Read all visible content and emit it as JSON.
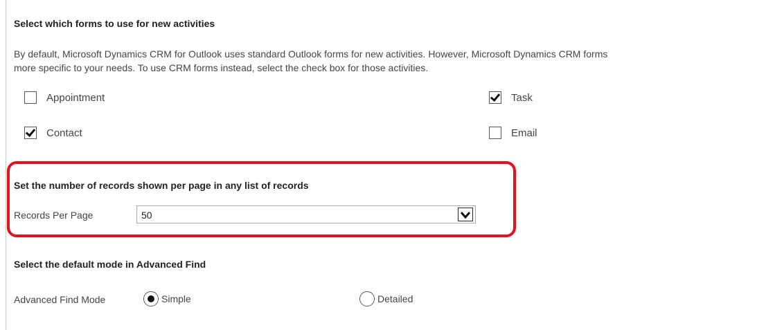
{
  "forms_section": {
    "heading": "Select which forms to use for new activities",
    "description_line1": "By default, Microsoft Dynamics CRM for Outlook uses standard Outlook forms for new activities. However, Microsoft Dynamics CRM forms",
    "description_line2": "more specific to your needs. To use CRM forms instead, select the check box for those activities.",
    "checkboxes": [
      {
        "label": "Appointment",
        "checked": false
      },
      {
        "label": "Task",
        "checked": true
      },
      {
        "label": "Contact",
        "checked": true
      },
      {
        "label": "Email",
        "checked": false
      }
    ]
  },
  "records_section": {
    "heading": "Set the number of records shown per page in any list of records",
    "field_label": "Records Per Page",
    "selected_value": "50",
    "highlight_color": "#e8101c"
  },
  "advanced_find_section": {
    "heading": "Select the default mode in Advanced Find",
    "field_label": "Advanced Find Mode",
    "options": [
      {
        "label": "Simple",
        "selected": true
      },
      {
        "label": "Detailed",
        "selected": false
      }
    ]
  }
}
